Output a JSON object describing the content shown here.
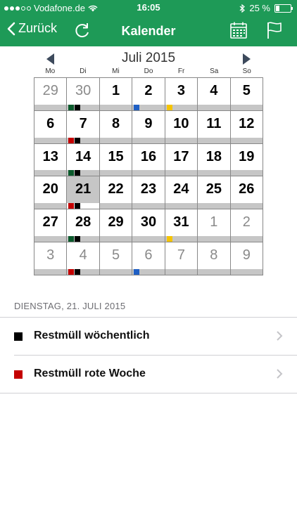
{
  "status": {
    "carrier": "Vodafone.de",
    "time": "16:05",
    "battery": "25 %",
    "battery_level": 0.25
  },
  "nav": {
    "back_label": "Zurück",
    "title": "Kalender",
    "accent": "#1e9a57"
  },
  "calendar": {
    "month_title": "Juli 2015",
    "weekdays": [
      "Mo",
      "Di",
      "Mi",
      "Do",
      "Fr",
      "Sa",
      "So"
    ],
    "marker_colors": {
      "black": "#000000",
      "green": "#0b5a2c",
      "red": "#c40000",
      "blue": "#1f5fc4",
      "yellow": "#f5c400"
    },
    "weeks": [
      [
        {
          "day": "29",
          "other": true
        },
        {
          "day": "30",
          "other": true,
          "markers": [
            "green",
            "black"
          ]
        },
        {
          "day": "1"
        },
        {
          "day": "2",
          "markers": [
            "blue"
          ]
        },
        {
          "day": "3",
          "markers": [
            "yellow"
          ]
        },
        {
          "day": "4"
        },
        {
          "day": "5"
        }
      ],
      [
        {
          "day": "6"
        },
        {
          "day": "7",
          "markers": [
            "red",
            "black"
          ]
        },
        {
          "day": "8"
        },
        {
          "day": "9"
        },
        {
          "day": "10"
        },
        {
          "day": "11"
        },
        {
          "day": "12"
        }
      ],
      [
        {
          "day": "13"
        },
        {
          "day": "14",
          "markers": [
            "green",
            "black"
          ]
        },
        {
          "day": "15"
        },
        {
          "day": "16"
        },
        {
          "day": "17"
        },
        {
          "day": "18"
        },
        {
          "day": "19"
        }
      ],
      [
        {
          "day": "20"
        },
        {
          "day": "21",
          "selected": true,
          "markers": [
            "red",
            "black"
          ]
        },
        {
          "day": "22"
        },
        {
          "day": "23"
        },
        {
          "day": "24"
        },
        {
          "day": "25"
        },
        {
          "day": "26"
        }
      ],
      [
        {
          "day": "27"
        },
        {
          "day": "28",
          "markers": [
            "green",
            "black"
          ]
        },
        {
          "day": "29"
        },
        {
          "day": "30"
        },
        {
          "day": "31",
          "markers": [
            "yellow"
          ]
        },
        {
          "day": "1",
          "other": true
        },
        {
          "day": "2",
          "other": true
        }
      ],
      [
        {
          "day": "3",
          "other": true
        },
        {
          "day": "4",
          "other": true,
          "markers": [
            "red",
            "black"
          ]
        },
        {
          "day": "5",
          "other": true
        },
        {
          "day": "6",
          "other": true,
          "markers": [
            "blue"
          ]
        },
        {
          "day": "7",
          "other": true
        },
        {
          "day": "8",
          "other": true
        },
        {
          "day": "9",
          "other": true
        }
      ]
    ]
  },
  "details": {
    "date_heading": "DIENSTAG, 21. JULI 2015",
    "items": [
      {
        "label": "Restmüll wöchentlich",
        "color": "#000000"
      },
      {
        "label": "Restmüll rote Woche",
        "color": "#c40000"
      }
    ]
  }
}
